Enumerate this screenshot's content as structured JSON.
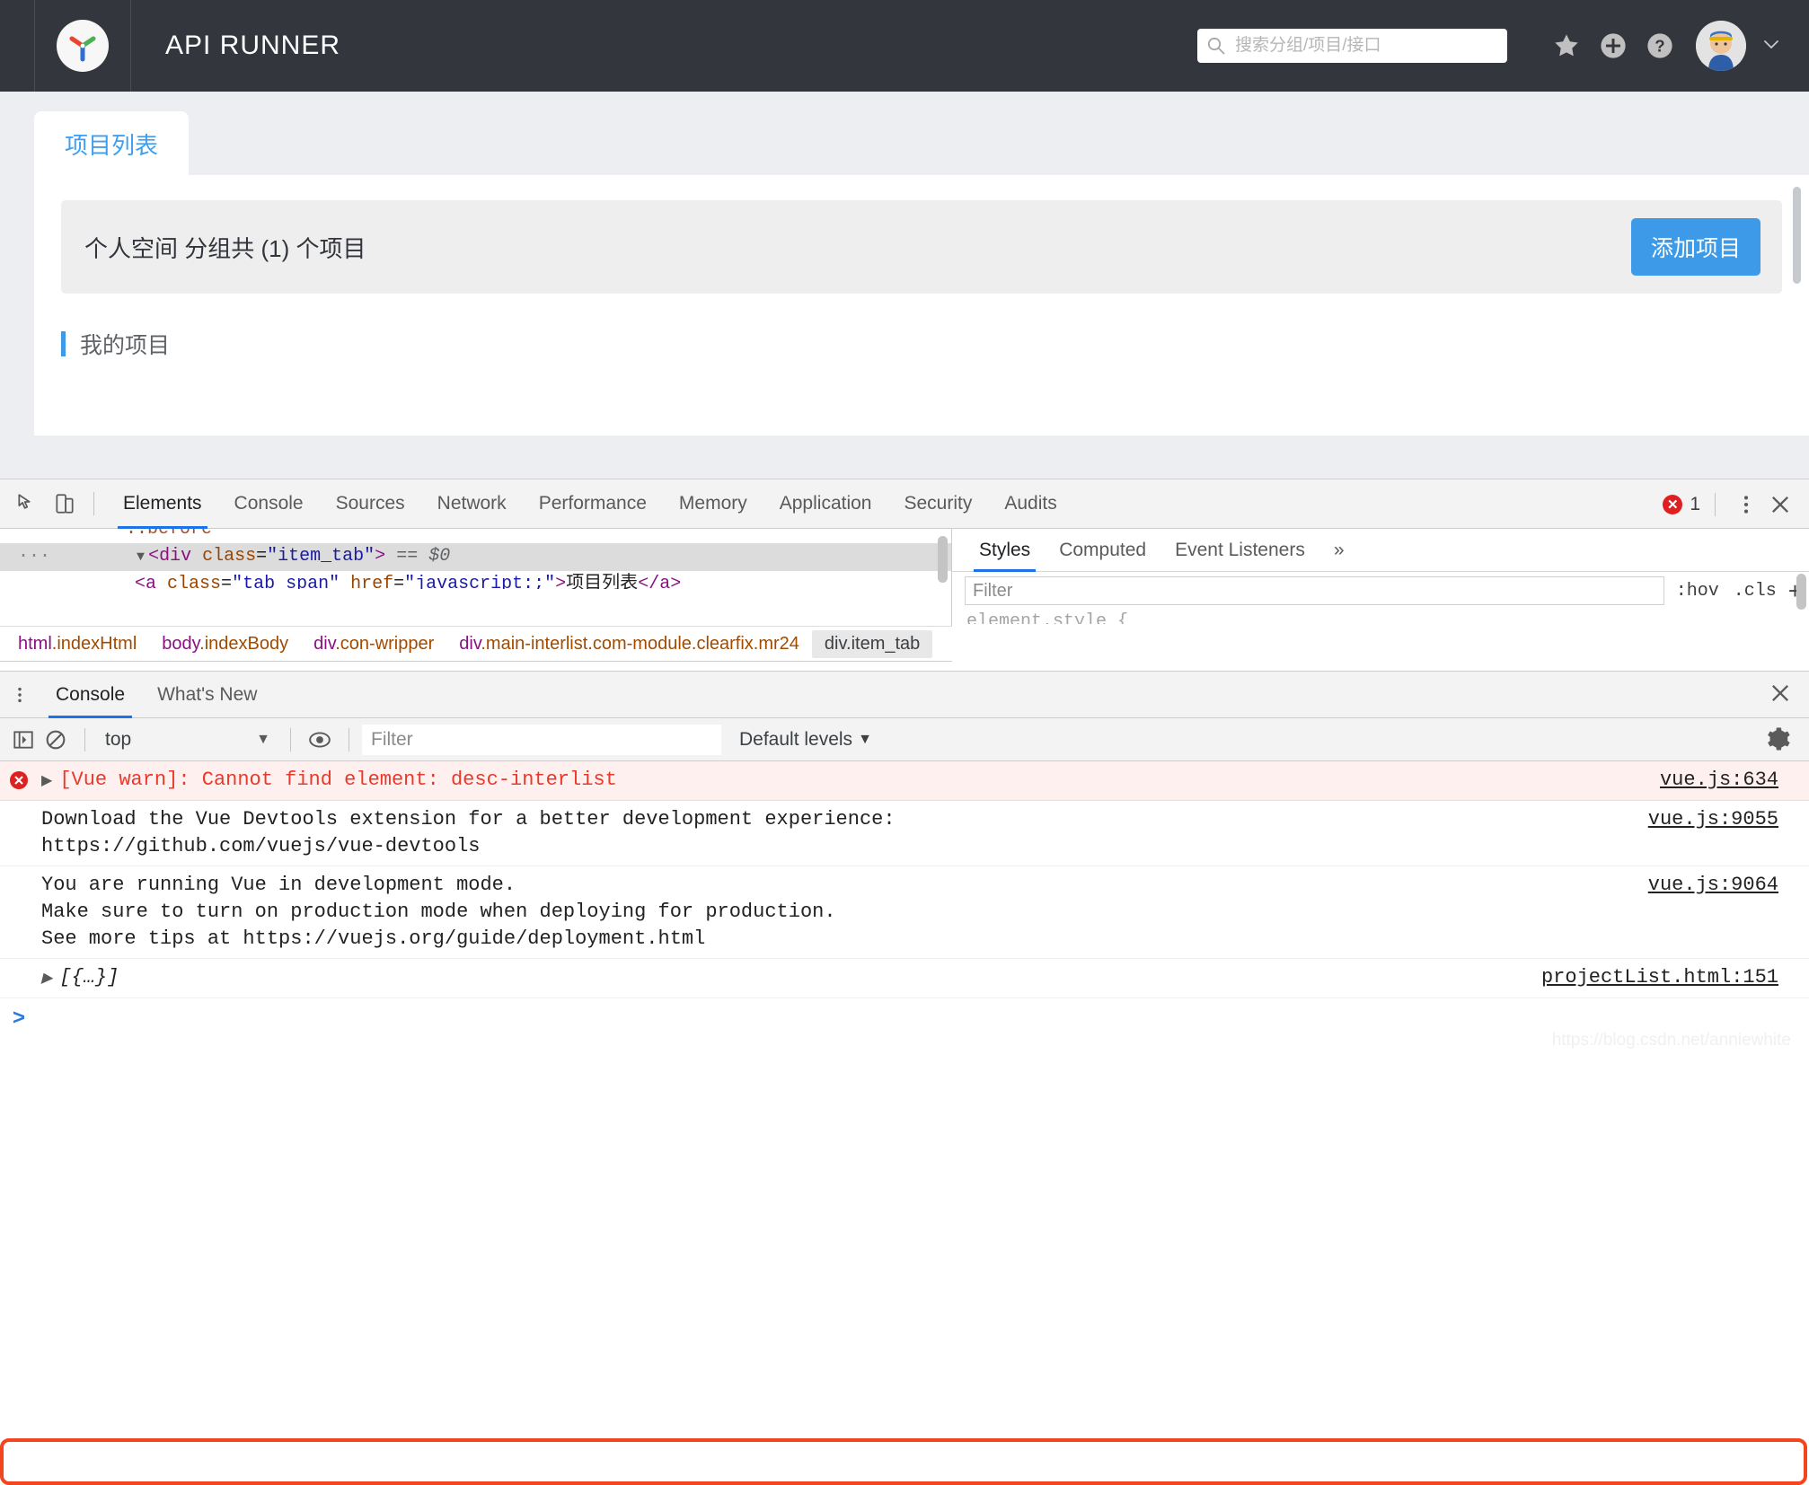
{
  "app": {
    "title": "API RUNNER",
    "logo_icon": "pinwheel-logo-icon",
    "logo_colors": {
      "arm1": "#e8452c",
      "arm2": "#4caf50",
      "arm3": "#2f6fd0"
    },
    "header_bg": "#33373d"
  },
  "search": {
    "placeholder": "搜索分组/项目/接口",
    "value": "",
    "icon": "search-icon"
  },
  "header_actions": {
    "star": "star-icon",
    "add": "plus-circle-icon",
    "help": "question-circle-icon",
    "avatar": "user-avatar",
    "chevron": "chevron-down-icon"
  },
  "page": {
    "tabs": [
      {
        "label": "项目列表",
        "active": true
      }
    ],
    "banner": {
      "text": "个人空间 分组共 (1) 个项目",
      "button_label": "添加项目",
      "button_color": "#3d9ae8"
    },
    "section_title": "我的项目",
    "accent_color": "#3d9ae8"
  },
  "devtools": {
    "toolbar_icons": {
      "inspect": "inspect-element-icon",
      "device": "device-toolbar-icon"
    },
    "tabs": [
      {
        "label": "Elements",
        "active": true
      },
      {
        "label": "Console",
        "active": false
      },
      {
        "label": "Sources",
        "active": false
      },
      {
        "label": "Network",
        "active": false
      },
      {
        "label": "Performance",
        "active": false
      },
      {
        "label": "Memory",
        "active": false
      },
      {
        "label": "Application",
        "active": false
      },
      {
        "label": "Security",
        "active": false
      },
      {
        "label": "Audits",
        "active": false
      }
    ],
    "error_count": "1",
    "more_icon": "vertical-dots-icon",
    "close_icon": "close-icon",
    "dom": {
      "line_pseudo": "::before",
      "line_selected": {
        "open": "<div",
        "attr_name": "class",
        "attr_value": "\"item_tab\"",
        "close": ">",
        "marker": "== $0"
      },
      "line_child": {
        "open": "<a",
        "attr1_name": "class",
        "attr1_value": "\"tab_span\"",
        "attr2_name": "href",
        "attr2_value": "\"javascript:;\"",
        "close": ">",
        "text": "项目列表",
        "end": "</a>"
      }
    },
    "breadcrumb": [
      {
        "tag": "html",
        "cls": ".indexHtml",
        "selected": false
      },
      {
        "tag": "body",
        "cls": ".indexBody",
        "selected": false
      },
      {
        "tag": "div",
        "cls": ".con-wripper",
        "selected": false
      },
      {
        "tag": "div",
        "cls": ".main-interlist.com-module.clearfix.mr24",
        "selected": false
      },
      {
        "tag": "div",
        "cls": ".item_tab",
        "selected": true
      }
    ],
    "styles": {
      "tabs": [
        {
          "label": "Styles",
          "active": true
        },
        {
          "label": "Computed",
          "active": false
        },
        {
          "label": "Event Listeners",
          "active": false
        },
        {
          "label": "»",
          "active": false
        }
      ],
      "filter_placeholder": "Filter",
      "filter_value": "",
      "hov_label": ":hov",
      "cls_label": ".cls",
      "plus_label": "+"
    }
  },
  "drawer": {
    "menu_icon": "vertical-dots-icon",
    "tabs": [
      {
        "label": "Console",
        "active": true
      },
      {
        "label": "What's New",
        "active": false
      }
    ],
    "close_icon": "close-icon",
    "toolbar": {
      "sidebar_icon": "console-sidebar-icon",
      "clear_icon": "clear-console-icon",
      "context_value": "top",
      "context_caret": "▼",
      "eye_icon": "live-expression-icon",
      "filter_placeholder": "Filter",
      "filter_value": "",
      "levels_label": "Default levels",
      "levels_caret": "▼",
      "settings_icon": "gear-icon"
    },
    "messages": [
      {
        "type": "error",
        "expandable": true,
        "arrow": "▶",
        "text": "[Vue warn]: Cannot find element: desc-interlist",
        "source": "vue.js:634",
        "annotated": true
      },
      {
        "type": "log",
        "expandable": false,
        "text": "Download the Vue Devtools extension for a better development experience:\nhttps://github.com/vuejs/vue-devtools",
        "link": "https://github.com/vuejs/vue-devtools",
        "source": "vue.js:9055"
      },
      {
        "type": "log",
        "expandable": false,
        "text": "You are running Vue in development mode.\nMake sure to turn on production mode when deploying for production.\nSee more tips at https://vuejs.org/guide/deployment.html",
        "link": "https://vuejs.org/guide/deployment.html",
        "source": "vue.js:9064"
      },
      {
        "type": "object",
        "expandable": true,
        "arrow": "▶",
        "text": "[{…}]",
        "source": "projectList.html:151"
      }
    ],
    "prompt_caret": ">",
    "prompt_value": ""
  },
  "watermark": "https://blog.csdn.net/anniewhite"
}
